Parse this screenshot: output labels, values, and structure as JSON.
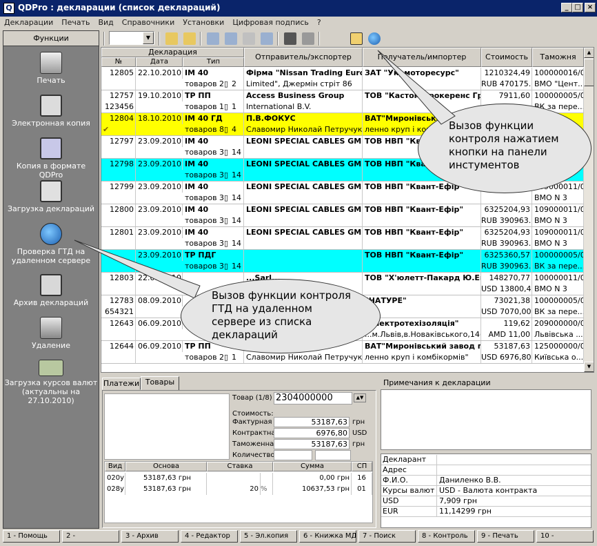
{
  "window": {
    "title": "QDPro : декларации (список деклараций)",
    "icon_letter": "Q"
  },
  "menu": [
    "Декларации",
    "Печать",
    "Вид",
    "Справочники",
    "Установки",
    "Цифровая подпись",
    "?"
  ],
  "left_panel": {
    "header": "Функции",
    "items": [
      {
        "label": "Печать",
        "icon": "printer-icon"
      },
      {
        "label": "Электронная копия",
        "icon": "floppy-icon"
      },
      {
        "label": "Копия в формате QDPro",
        "icon": "qdpro-copy-icon"
      },
      {
        "label": "Загрузка деклараций",
        "icon": "calculator-icon"
      },
      {
        "label": "Проверка ГТД на удаленном сервере",
        "icon": "globe-document-icon"
      },
      {
        "label": "Архив деклараций",
        "icon": "archive-icon"
      },
      {
        "label": "Удаление",
        "icon": "shredder-icon"
      },
      {
        "label": "Загрузка курсов валют (актуальны на 27.10.2010)",
        "icon": "banknote-icon"
      }
    ]
  },
  "grid": {
    "headers": {
      "declaration": "Декларация",
      "num": "№",
      "date": "Дата",
      "type": "Тип",
      "sender": "Отправитель/экспортер",
      "receiver": "Получатель/импортер",
      "cost": "Стоимость",
      "customs": "Таможня"
    },
    "rows": [
      {
        "num": "12805",
        "num2": "",
        "date": "22.10.2010",
        "type": "IM  40",
        "goods": "товаров 2",
        "pages": "2",
        "sender1": "Фірма \"Nissan Trading Europe",
        "sender2": "Limited\", Джермін стріт 86",
        "recv1": "ЗАТ \"Укрмоторесурс\"",
        "recv2": "",
        "cost1": "1210324,49",
        "cost2": "RUB 470175...",
        "cust1": "100000016/0/",
        "cust2": "ВМО \"Цент...",
        "hl": ""
      },
      {
        "num": "12757",
        "num2": "123456",
        "date": "19.10.2010",
        "type": "TP      ПП",
        "goods": "товаров 1",
        "pages": "1",
        "sender1": "Access Business Group",
        "sender2": "International B.V.",
        "recv1": "ТОВ \"Кастом Брокеренс Груп\"",
        "recv2": "",
        "cost1": "7911,60",
        "cost2": "",
        "cust1": "100000005/0/",
        "cust2": "ВК за пере...",
        "hl": ""
      },
      {
        "num": "12804",
        "num2": "",
        "date": "18.10.2010",
        "type": "IM  40  ГД",
        "goods": "товаров 8",
        "pages": "4",
        "sender1": "П.В.ФОКУС",
        "sender2": "Славомир Николай Петручук",
        "recv1": "ВАТ\"Миронівський",
        "recv2": "ленно круп і комбі",
        "cost1": "",
        "cost2": "",
        "cust1": "",
        "cust2": "",
        "hl": "yellow"
      },
      {
        "num": "12797",
        "num2": "",
        "date": "23.09.2010",
        "type": "IM  40",
        "goods": "товаров 38",
        "pages": "14",
        "sender1": "LEONI SPECIAL CABLES GMBH",
        "sender2": "",
        "recv1": "ТОВ НВП \"Квант",
        "recv2": "",
        "cost1": "",
        "cost2": "",
        "cust1": "",
        "cust2": "",
        "hl": ""
      },
      {
        "num": "12798",
        "num2": "",
        "date": "23.09.2010",
        "type": "IM  40",
        "goods": "товаров 38",
        "pages": "14",
        "sender1": "LEONI SPECIAL CABLES GMBH",
        "sender2": "",
        "recv1": "ТОВ НВП \"Квант",
        "recv2": "",
        "cost1": "",
        "cost2": "",
        "cust1": "",
        "cust2": "",
        "hl": "cyan"
      },
      {
        "num": "12799",
        "num2": "",
        "date": "23.09.2010",
        "type": "IM  40",
        "goods": "товаров 38",
        "pages": "14",
        "sender1": "LEONI SPECIAL CABLES GMBH",
        "sender2": "",
        "recv1": "ТОВ НВП \"Квант-Ефір\"",
        "recv2": "",
        "cost1": "",
        "cost2": "",
        "cust1": "109000011/0/",
        "cust2": "ВМО N 3",
        "hl": ""
      },
      {
        "num": "12800",
        "num2": "",
        "date": "23.09.2010",
        "type": "IM  40",
        "goods": "товаров 38",
        "pages": "14",
        "sender1": "LEONI SPECIAL CABLES GMBH",
        "sender2": "",
        "recv1": "ТОВ НВП \"Квант-Ефір\"",
        "recv2": "",
        "cost1": "6325204,93",
        "cost2": "RUB 390963...",
        "cust1": "109000011/0/",
        "cust2": "ВМО N 3",
        "hl": ""
      },
      {
        "num": "12801",
        "num2": "",
        "date": "23.09.2010",
        "type": "IM  40",
        "goods": "товаров 38",
        "pages": "14",
        "sender1": "LEONI SPECIAL CABLES GMBH",
        "sender2": "",
        "recv1": "ТОВ НВП \"Квант-Ефір\"",
        "recv2": "",
        "cost1": "6325204,93",
        "cost2": "RUB 390963...",
        "cust1": "109000011/0/",
        "cust2": "ВМО N 3",
        "hl": ""
      },
      {
        "num": "",
        "num2": "",
        "date": "23.09.2010",
        "type": "TP      ПДГ",
        "goods": "товаров 38",
        "pages": "14",
        "sender1": "",
        "sender2": "",
        "recv1": "ТОВ НВП \"Квант-Ефір\"",
        "recv2": "",
        "cost1": "6325360,57",
        "cost2": "RUB 390963...",
        "cust1": "100000005/0/",
        "cust2": "ВК за пере...",
        "hl": "cyan"
      },
      {
        "num": "12803",
        "num2": "",
        "date": "22.09.2010",
        "type": "",
        "goods": "",
        "pages": "",
        "sender1": "...Sarl...",
        "sender2": "",
        "recv1": "ТОВ \"Х'юлетт-Пакард Ю.Ей\"",
        "recv2": "",
        "cost1": "148270,77",
        "cost2": "USD 13800,43",
        "cust1": "100000011/0/",
        "cust2": "ВМО N 3",
        "hl": ""
      },
      {
        "num": "12783",
        "num2": "654321",
        "date": "08.09.2010",
        "type": "",
        "goods": "",
        "pages": "",
        "sender1": "",
        "sender2": "",
        "recv1": "\"НАТУРЕ\"",
        "recv2": "",
        "cost1": "73021,38",
        "cost2": "USD 7070,00",
        "cust1": "100000005/0/",
        "cust2": "ВК за пере...",
        "hl": ""
      },
      {
        "num": "12643",
        "num2": "",
        "date": "06.09.2010",
        "type": "",
        "goods": "",
        "pages": "",
        "sender1": "",
        "sender2": "",
        "recv1": "\"Електротехізоляція\"",
        "recv2": "...м.Львів,в.Новаківського,14(ф...",
        "cost1": "119,62",
        "cost2": "AMD 11,00",
        "cust1": "209000000/0/",
        "cust2": "Львівська ...",
        "hl": ""
      },
      {
        "num": "12644",
        "num2": "",
        "date": "06.09.2010",
        "type": "TP      ПП",
        "goods": "товаров 2",
        "pages": "1",
        "sender1": "П.В.ФОКУС",
        "sender2": "Славомир Николай Петручук",
        "recv1": "ВАТ\"Миронівський завод п...",
        "recv2": "ленно круп і комбікормів\"",
        "cost1": "53187,63",
        "cost2": "USD 6976,80",
        "cust1": "125000000/0/",
        "cust2": "Київська о...",
        "hl": ""
      }
    ]
  },
  "details": {
    "tabs": [
      "Платежи",
      "Товары"
    ],
    "goods_label": "Товар (1/8)",
    "goods_code": "2304000000",
    "cost_label": "Стоимость:",
    "rows": [
      {
        "label": "Фактурная",
        "value": "53187,63",
        "cur": "грн"
      },
      {
        "label": "Контрактная",
        "value": "6976,80",
        "cur": "USD"
      },
      {
        "label": "Таможенная",
        "value": "53187,63",
        "cur": "грн"
      },
      {
        "label": "Количество",
        "value": "",
        "cur": ""
      }
    ],
    "pay_headers": [
      "Вид",
      "Основа",
      "Ставка",
      "Сумма",
      "СП"
    ],
    "payments": [
      {
        "kind": "020у",
        "base": "53187,63 грн",
        "rate": "",
        "rate_unit": "",
        "sum": "0,00 грн",
        "sp": "16"
      },
      {
        "kind": "028у",
        "base": "53187,63 грн",
        "rate": "20",
        "rate_unit": "%",
        "sum": "10637,53 грн",
        "sp": "01"
      }
    ]
  },
  "notes": {
    "title": "Примечания к декларации"
  },
  "info": [
    {
      "label": "Декларант",
      "value": ""
    },
    {
      "label": "Адрес",
      "value": ""
    },
    {
      "label": "Ф.И.О.",
      "value": "Даниленко В.В."
    },
    {
      "label": "Курсы валют",
      "value": "USD - Валюта контракта"
    },
    {
      "label": "USD",
      "value": "7,909 грн"
    },
    {
      "label": "EUR",
      "value": "11,14299 грн"
    }
  ],
  "fkeys": [
    "1 - Помощь",
    "2 -",
    "3 - Архив",
    "4 - Редактор",
    "5 - Эл.копия",
    "6 - Книжка МДП",
    "7 - Поиск",
    "8 - Контроль",
    "9 - Печать",
    "10 -"
  ],
  "callouts": {
    "toolbar": "Вызов функции контроля нажатием кнопки на панели инстументов",
    "list": "Вызов функции контроля ГТД на удаленном сервере из списка деклараций"
  },
  "colors": {
    "title_bg": "#0a246a",
    "highlight_yellow": "#ffff00",
    "highlight_cyan": "#00ffff",
    "panel_gray": "#808080"
  }
}
